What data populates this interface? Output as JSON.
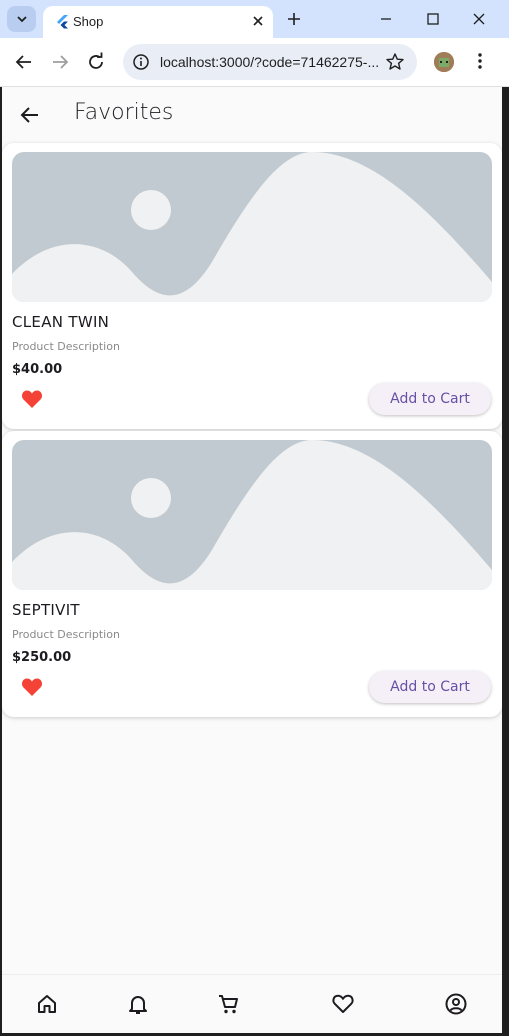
{
  "browser": {
    "tab_title": "Shop",
    "url": "localhost:3000/?code=71462275-..."
  },
  "icons": {
    "tab_dropdown": "chevron-down-icon",
    "favicon": "flutter-icon",
    "tab_close": "close-icon",
    "new_tab": "plus-icon",
    "minimize": "minimize-icon",
    "maximize": "maximize-icon",
    "close_window": "close-icon",
    "back": "arrow-left-icon",
    "forward": "arrow-right-icon",
    "reload": "reload-icon",
    "site_info": "site-info-icon",
    "bookmark": "star-icon",
    "menu": "kebab-icon",
    "page_back": "arrow-left-icon",
    "favorite": "heart-filled-icon",
    "nav_home": "home-icon",
    "nav_notifications": "bell-icon",
    "nav_cart": "cart-icon",
    "nav_favorites": "heart-outline-icon",
    "nav_account": "account-icon"
  },
  "page": {
    "title": "Favorites"
  },
  "products": [
    {
      "name": "CLEAN TWIN",
      "description": "Product Description",
      "price": "$40.00",
      "add_label": "Add to Cart"
    },
    {
      "name": "SEPTIVIT",
      "description": "Product Description",
      "price": "$250.00",
      "add_label": "Add to Cart"
    }
  ],
  "colors": {
    "chrome_bg": "#d3e3fd",
    "accent": "#6750a4",
    "favorite_red": "#f44336",
    "placeholder_fg": "#c2cad1",
    "placeholder_bg": "#f0f1f2"
  }
}
